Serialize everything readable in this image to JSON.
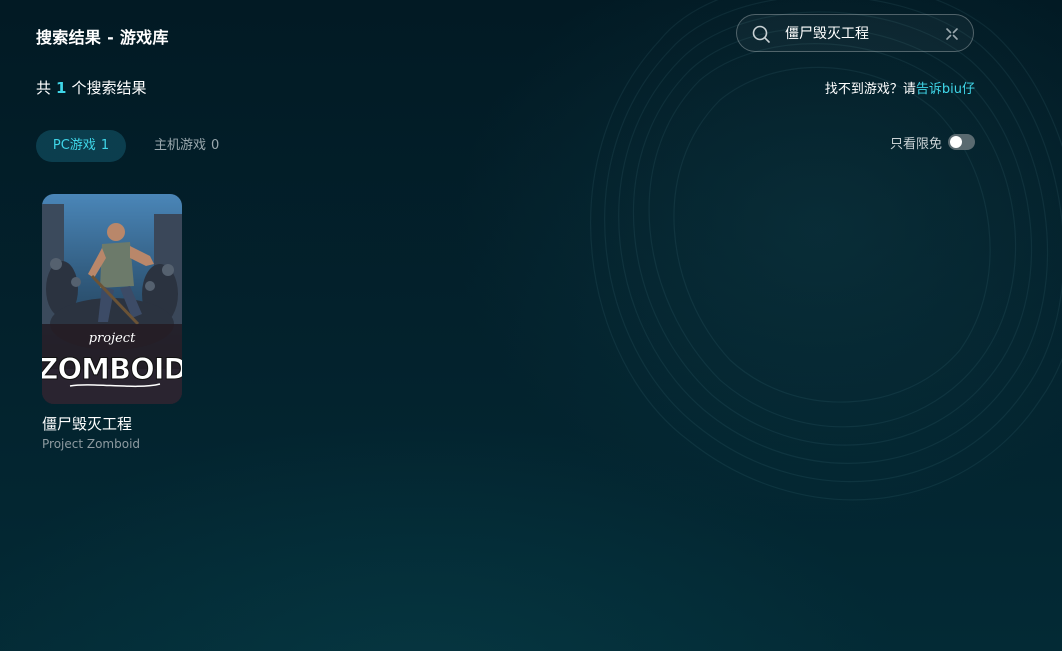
{
  "page": {
    "title": "搜索结果 - 游戏库"
  },
  "search": {
    "value": "僵尸毁灭工程",
    "placeholder": ""
  },
  "results": {
    "prefix": "共",
    "count": "1",
    "suffix": "个搜索结果"
  },
  "help": {
    "text": "找不到游戏？请",
    "link": "告诉biu仔"
  },
  "tabs": [
    {
      "label": "PC游戏",
      "count": "1",
      "active": true
    },
    {
      "label": "主机游戏",
      "count": "0",
      "active": false
    }
  ],
  "filter": {
    "label": "只看限免",
    "enabled": false
  },
  "games": [
    {
      "name": "僵尸毁灭工程",
      "english_name": "Project Zomboid",
      "cover_logo_top": "project",
      "cover_logo_main": "ZOMBOID"
    }
  ],
  "colors": {
    "accent": "#3fd6e8",
    "background": "#021a24",
    "tab_active_bg": "#145a6e"
  },
  "icons": {
    "search": "search-icon",
    "clear": "close-icon"
  }
}
